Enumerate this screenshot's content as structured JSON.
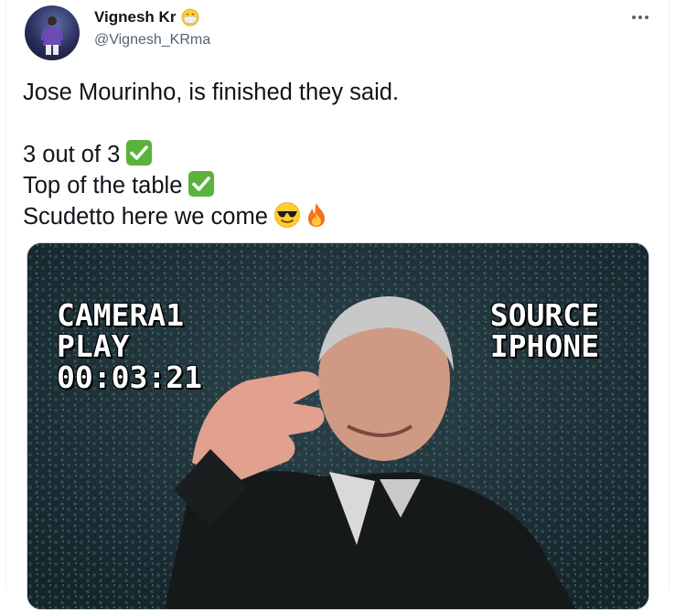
{
  "author": {
    "display_name": "Vignesh Kr",
    "name_emoji": "face-with-medical-mask-icon",
    "handle": "@Vignesh_KRma"
  },
  "tweet": {
    "line1": "Jose Mourinho, is finished they said.",
    "line2": "3 out of 3",
    "line2_emoji": "check-mark-button-icon",
    "line3": "Top of the table",
    "line3_emoji": "check-mark-button-icon",
    "line4": "Scudetto here we come",
    "line4_emojis": [
      "smiling-face-with-sunglasses-icon",
      "fire-icon"
    ]
  },
  "media": {
    "osd_left": [
      "CAMERA1",
      "PLAY",
      "00:03:21"
    ],
    "osd_right": [
      "SOURCE",
      "IPHONE"
    ]
  },
  "colors": {
    "text": "#0f1419",
    "secondary": "#536471",
    "check_green": "#5bb33e",
    "border": "#cfd9de"
  }
}
